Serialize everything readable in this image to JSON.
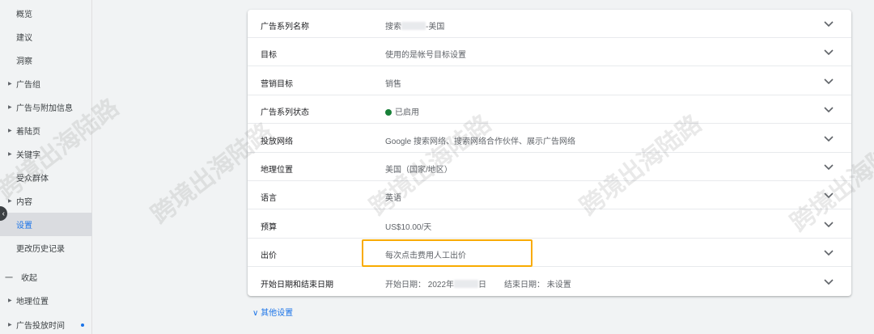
{
  "sidebar": {
    "items": [
      {
        "label": "概览",
        "arrow": false
      },
      {
        "label": "建议",
        "arrow": false
      },
      {
        "label": "洞察",
        "arrow": false
      },
      {
        "label": "广告组",
        "arrow": true
      },
      {
        "label": "广告与附加信息",
        "arrow": true
      },
      {
        "label": "着陆页",
        "arrow": true
      },
      {
        "label": "关键字",
        "arrow": true
      },
      {
        "label": "受众群体",
        "arrow": false
      },
      {
        "label": "内容",
        "arrow": true
      },
      {
        "label": "设置",
        "arrow": false,
        "active": true
      },
      {
        "label": "更改历史记录",
        "arrow": false
      },
      {
        "label": "收起",
        "arrow": false
      },
      {
        "label": "地理位置",
        "arrow": true
      },
      {
        "label": "广告投放时间",
        "arrow": true
      }
    ],
    "collapse_symbol": "一"
  },
  "settings": {
    "rows": [
      {
        "label": "广告系列名称",
        "value_prefix": "搜索",
        "value_suffix": "-美国"
      },
      {
        "label": "目标",
        "value": "使用的是帐号目标设置"
      },
      {
        "label": "营销目标",
        "value": "销售"
      },
      {
        "label": "广告系列状态",
        "value": "已启用"
      },
      {
        "label": "投放网络",
        "value": "Google 搜索网络、搜索网络合作伙伴、展示广告网络"
      },
      {
        "label": "地理位置",
        "value": "美国（国家/地区）"
      },
      {
        "label": "语言",
        "value": "英语"
      },
      {
        "label": "预算",
        "value": "US$10.00/天"
      },
      {
        "label": "出价",
        "value": "每次点击费用人工出价"
      },
      {
        "label": "开始日期和结束日期",
        "value_prefix": "开始日期： 2022年",
        "value_suffix": "日",
        "end_label": "结束日期： 未设置"
      }
    ]
  },
  "more_settings": "其他设置",
  "more_settings_icon": "chevron-down-icon",
  "watermark_text": "跨境出海陆路",
  "colors": {
    "accent": "#1a73e8",
    "status_green": "#188038",
    "highlight": "#f9ab00"
  }
}
